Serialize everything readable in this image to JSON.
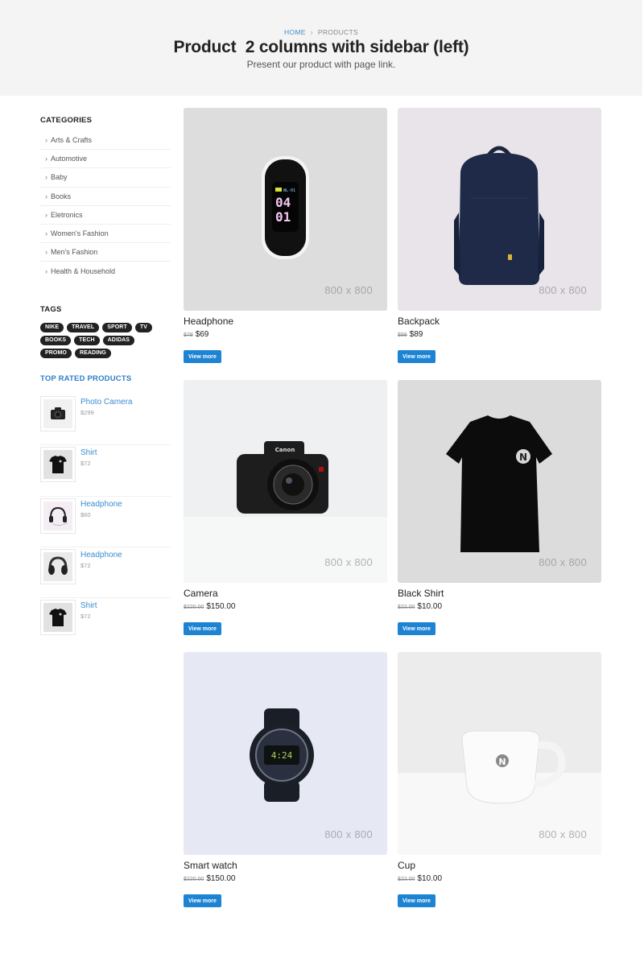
{
  "breadcrumb": {
    "home": "HOME",
    "separator": "›",
    "current": "PRODUCTS"
  },
  "page": {
    "title": "Product  2 columns with sidebar (left)",
    "subtitle": "Present our product with page link."
  },
  "sidebar": {
    "categories_heading": "CATEGORIES",
    "categories": [
      "Arts & Crafts",
      "Automotive",
      "Baby",
      "Books",
      "Eletronics",
      "Women's Fashion",
      "Men's Fashion",
      "Health & Household"
    ],
    "tags_heading": "TAGS",
    "tags": [
      "NIKE",
      "TRAVEL",
      "SPORT",
      "TV",
      "BOOKS",
      "TECH",
      "ADIDAS",
      "PROMO",
      "READING"
    ],
    "top_rated_heading": "TOP RATED PRODUCTS",
    "top_rated": [
      {
        "name": "Photo Camera",
        "price": "$299"
      },
      {
        "name": "Shirt",
        "price": "$72"
      },
      {
        "name": "Headphone",
        "price": "$60"
      },
      {
        "name": "Headphone",
        "price": "$72"
      },
      {
        "name": "Shirt",
        "price": "$72"
      }
    ]
  },
  "image_placeholder": "800 x 800",
  "products": [
    {
      "name": "Headphone",
      "old_price": "$79",
      "price": "$69",
      "button": "View more"
    },
    {
      "name": "Backpack",
      "old_price": "$99",
      "price": "$89",
      "button": "View more"
    },
    {
      "name": "Camera",
      "old_price": "$220.00",
      "price": "$150.00",
      "button": "View more"
    },
    {
      "name": "Black Shirt",
      "old_price": "$22.00",
      "price": "$10.00",
      "button": "View more"
    },
    {
      "name": "Smart watch",
      "old_price": "$220.00",
      "price": "$150.00",
      "button": "View more"
    },
    {
      "name": "Cup",
      "old_price": "$22.00",
      "price": "$10.00",
      "button": "View more"
    }
  ],
  "colors": {
    "accent": "#1d83d3",
    "link": "#3c8bd1",
    "tag_bg": "#222222",
    "header_bg": "#f4f4f4"
  }
}
